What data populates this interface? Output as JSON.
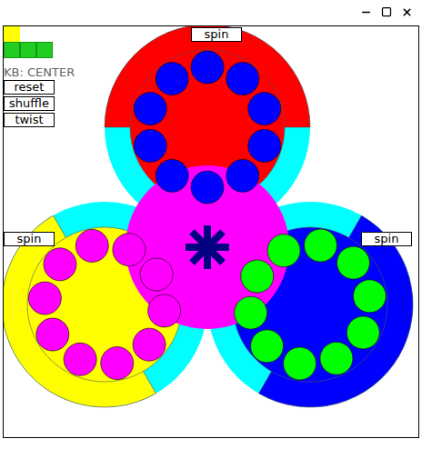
{
  "indicators": {
    "top": [
      "#ffff00"
    ],
    "bottom": [
      "#22cc22",
      "#22cc22",
      "#22cc22"
    ]
  },
  "keyboard_label": "KB: CENTER",
  "buttons": [
    "reset",
    "shuffle",
    "twist"
  ],
  "center": {
    "color": "#ff00ff",
    "star_color": "#000080"
  },
  "background_color": "#00ffff",
  "wheels": [
    {
      "name": "top",
      "color": "#ff0000",
      "spin_label": "spin",
      "balls": [
        "#0000ff",
        "#0000ff",
        "#0000ff",
        "#0000ff",
        "#0000ff",
        "#0000ff",
        "#0000ff",
        "#0000ff",
        "#0000ff",
        "#0000ff"
      ]
    },
    {
      "name": "left",
      "color": "#ffff00",
      "spin_label": "spin",
      "balls": [
        "#ff00ff",
        "#ff00ff",
        "#ff00ff",
        "#ff00ff",
        "#ff00ff",
        "#ff00ff",
        "#ff00ff",
        "#ff00ff",
        "#ff00ff",
        "#ff00ff"
      ]
    },
    {
      "name": "right",
      "color": "#0000ff",
      "spin_label": "spin",
      "balls": [
        "#00ff00",
        "#00ff00",
        "#00ff00",
        "#00ff00",
        "#00ff00",
        "#00ff00",
        "#00ff00",
        "#00ff00",
        "#00ff00",
        "#00ff00"
      ]
    }
  ]
}
